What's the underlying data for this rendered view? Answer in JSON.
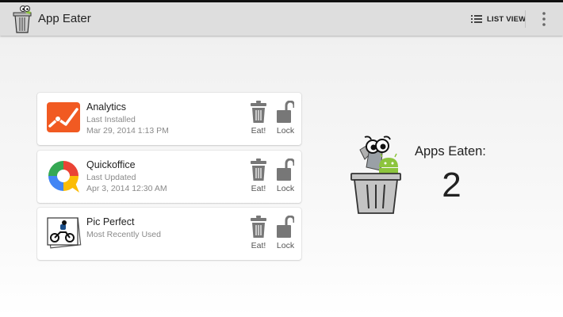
{
  "actionbar": {
    "title": "App Eater",
    "app_icon": "trash-bin-eater-icon",
    "list_view_icon": "list-icon",
    "list_view_label": "LIST VIEW",
    "overflow_icon": "vertical-dots-icon"
  },
  "apps": [
    {
      "name": "Analytics",
      "status": "Last Installed",
      "date": "Mar 29, 2014 1:13 PM",
      "icon": "analytics-icon",
      "eat_label": "Eat!",
      "lock_label": "Lock"
    },
    {
      "name": "Quickoffice",
      "status": "Last Updated",
      "date": "Apr 3, 2014 12:30 AM",
      "icon": "quickoffice-icon",
      "eat_label": "Eat!",
      "lock_label": "Lock"
    },
    {
      "name": "Pic Perfect",
      "status": "Most Recently Used",
      "date": "",
      "icon": "pic-perfect-icon",
      "eat_label": "Eat!",
      "lock_label": "Lock"
    }
  ],
  "stats": {
    "label": "Apps Eaten:",
    "count": "2",
    "icon": "trash-bin-eater-icon"
  },
  "colors": {
    "actionbar_bg": "#dedede",
    "analytics_orange": "#f15a22",
    "icon_gray": "#777777",
    "android_green": "#8cc43c"
  }
}
